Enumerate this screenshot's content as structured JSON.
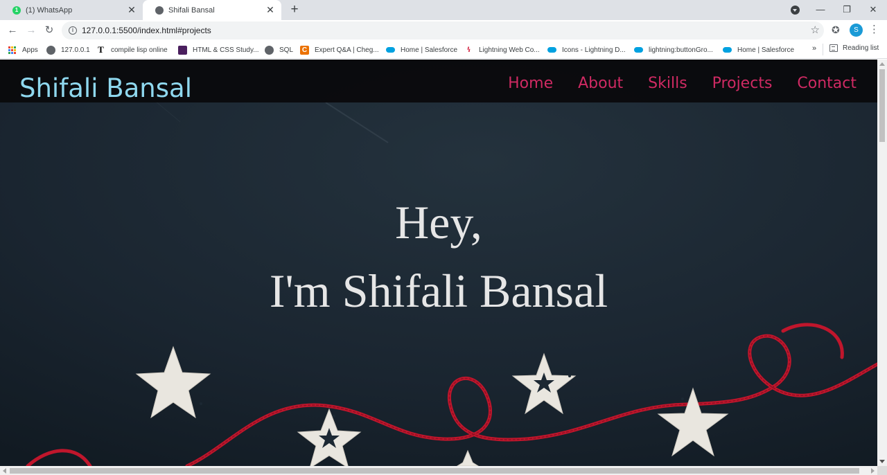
{
  "browser": {
    "tabs": [
      {
        "title": "(1) WhatsApp",
        "badge": "1",
        "active": false,
        "icon": "whatsapp-icon"
      },
      {
        "title": "Shifali Bansal",
        "active": true,
        "icon": "globe-icon"
      }
    ],
    "new_tab_label": "+",
    "address": "127.0.0.1:5500/index.html#projects",
    "profile_initial": "S",
    "window_controls": {
      "minimize": "—",
      "restore": "❐",
      "close": "✕"
    }
  },
  "bookmarks": {
    "items": [
      {
        "label": "Apps",
        "icon": "apps-grid-icon"
      },
      {
        "label": "127.0.0.1",
        "icon": "globe-icon"
      },
      {
        "label": "compile lisp online",
        "icon": "t-icon",
        "glyph": "T"
      },
      {
        "label": "HTML & CSS Study...",
        "icon": "purple-app-icon"
      },
      {
        "label": "SQL",
        "icon": "globe-icon"
      },
      {
        "label": "Expert Q&A | Cheg...",
        "icon": "chegg-icon",
        "glyph": "C"
      },
      {
        "label": "Home | Salesforce",
        "icon": "salesforce-cloud-icon"
      },
      {
        "label": "Lightning Web Co...",
        "icon": "lightning-web-icon",
        "glyph": "ꝇ"
      },
      {
        "label": "Icons - Lightning D...",
        "icon": "salesforce-cloud-icon"
      },
      {
        "label": "lightning:buttonGro...",
        "icon": "salesforce-cloud-icon"
      },
      {
        "label": "Home | Salesforce",
        "icon": "salesforce-cloud-icon"
      }
    ],
    "more": "»",
    "reading_list": "Reading list"
  },
  "site": {
    "logo": "Shifali Bansal",
    "nav": [
      "Home",
      "About",
      "Skills",
      "Projects",
      "Contact"
    ],
    "hero_line1": "Hey,",
    "hero_line2": "I'm Shifali Bansal"
  },
  "colors": {
    "logo": "#8fd8ef",
    "nav_link": "#cf2a63",
    "hero_text": "#e6e6e6",
    "background": "#1b2631",
    "yarn": "#c0162c",
    "star": "#e9e6df"
  }
}
